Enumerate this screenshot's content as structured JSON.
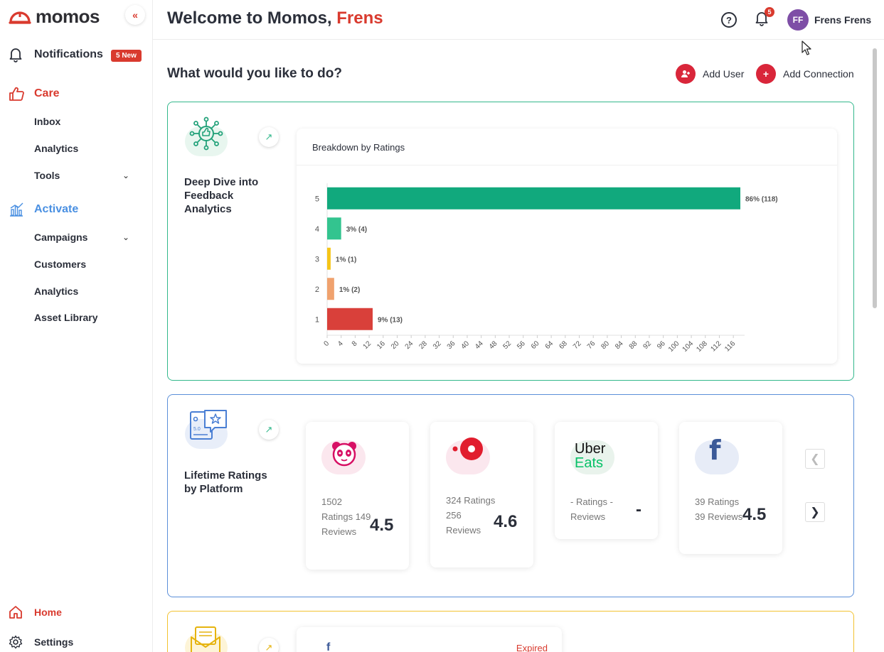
{
  "brand": {
    "name": "momos",
    "accent": "#d93a2e"
  },
  "sidebar": {
    "collapse_icon": "«",
    "notifications": {
      "label": "Notifications",
      "badge": "5 New"
    },
    "care": {
      "label": "Care",
      "items": [
        "Inbox",
        "Analytics",
        "Tools"
      ]
    },
    "activate": {
      "label": "Activate",
      "items": [
        "Campaigns",
        "Customers",
        "Analytics",
        "Asset Library"
      ]
    },
    "bottom": {
      "home": "Home",
      "settings": "Settings"
    }
  },
  "header": {
    "welcome": "Welcome to Momos,",
    "user_first": "Frens",
    "bell_count": "5",
    "avatar_initials": "FF",
    "user_name": "Frens Frens"
  },
  "main": {
    "question": "What would you like to do?",
    "add_user": "Add User",
    "add_connection": "Add Connection",
    "card1_title": "Deep Dive into Feedback Analytics",
    "card2_title": "Lifetime Ratings by Platform",
    "expired": "Expired"
  },
  "chart_data": {
    "type": "bar",
    "orientation": "horizontal",
    "title": "Breakdown by Ratings",
    "categories": [
      "5",
      "4",
      "3",
      "2",
      "1"
    ],
    "values": [
      118,
      4,
      1,
      2,
      13
    ],
    "labels": [
      "86% (118)",
      "3% (4)",
      "1% (1)",
      "1% (2)",
      "9% (13)"
    ],
    "colors": [
      "#11a97d",
      "#33c48f",
      "#f5c518",
      "#f0a26e",
      "#d9403a"
    ],
    "xlim": [
      0,
      118
    ],
    "xticks": [
      0,
      4,
      8,
      12,
      16,
      20,
      24,
      28,
      32,
      36,
      40,
      44,
      48,
      52,
      56,
      60,
      64,
      68,
      72,
      76,
      80,
      84,
      88,
      92,
      96,
      100,
      104,
      108,
      112,
      116
    ]
  },
  "platforms": [
    {
      "name": "foodpanda",
      "counts": "1502 Ratings 149 Reviews",
      "rating": "4.5"
    },
    {
      "name": "deliveroo",
      "counts": "324 Ratings 256 Reviews",
      "rating": "4.6"
    },
    {
      "name": "Uber Eats",
      "logo_top": "Uber",
      "logo_bottom": "Eats",
      "counts": "- Ratings - Reviews",
      "rating": "-"
    },
    {
      "name": "facebook",
      "logo": "f",
      "counts": "39 Ratings 39 Reviews",
      "rating": "4.5"
    }
  ]
}
